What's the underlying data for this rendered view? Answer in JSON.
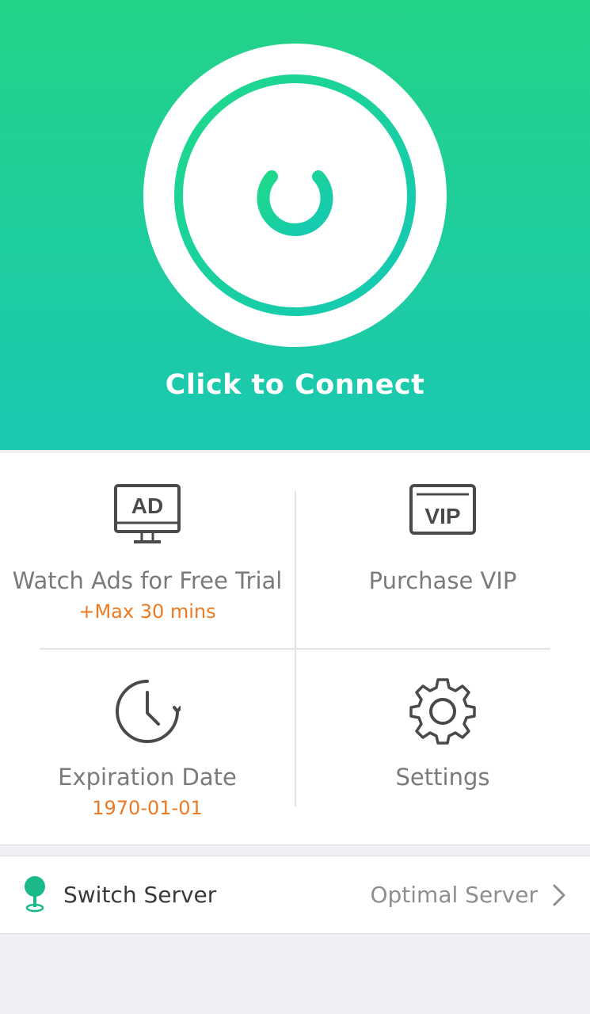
{
  "colors": {
    "accent_green": "#23d387",
    "accent_teal": "#1ac8b1",
    "orange": "#ec7a22",
    "icon_gray": "#4a4a4a"
  },
  "hero": {
    "power_icon": "power-icon",
    "connect_label": "Click to Connect"
  },
  "grid": {
    "watch_ads": {
      "icon": "ad-monitor-icon",
      "icon_text": "AD",
      "title": "Watch Ads for Free Trial",
      "subtitle": "+Max 30 mins"
    },
    "purchase_vip": {
      "icon": "vip-ticket-icon",
      "icon_text": "VIP",
      "title": "Purchase VIP"
    },
    "expiration": {
      "icon": "clock-icon",
      "title": "Expiration Date",
      "subtitle": "1970-01-01"
    },
    "settings": {
      "icon": "gear-icon",
      "title": "Settings"
    }
  },
  "server": {
    "icon": "location-pin-icon",
    "label": "Switch Server",
    "value": "Optimal Server",
    "chevron": "chevron-right-icon"
  }
}
